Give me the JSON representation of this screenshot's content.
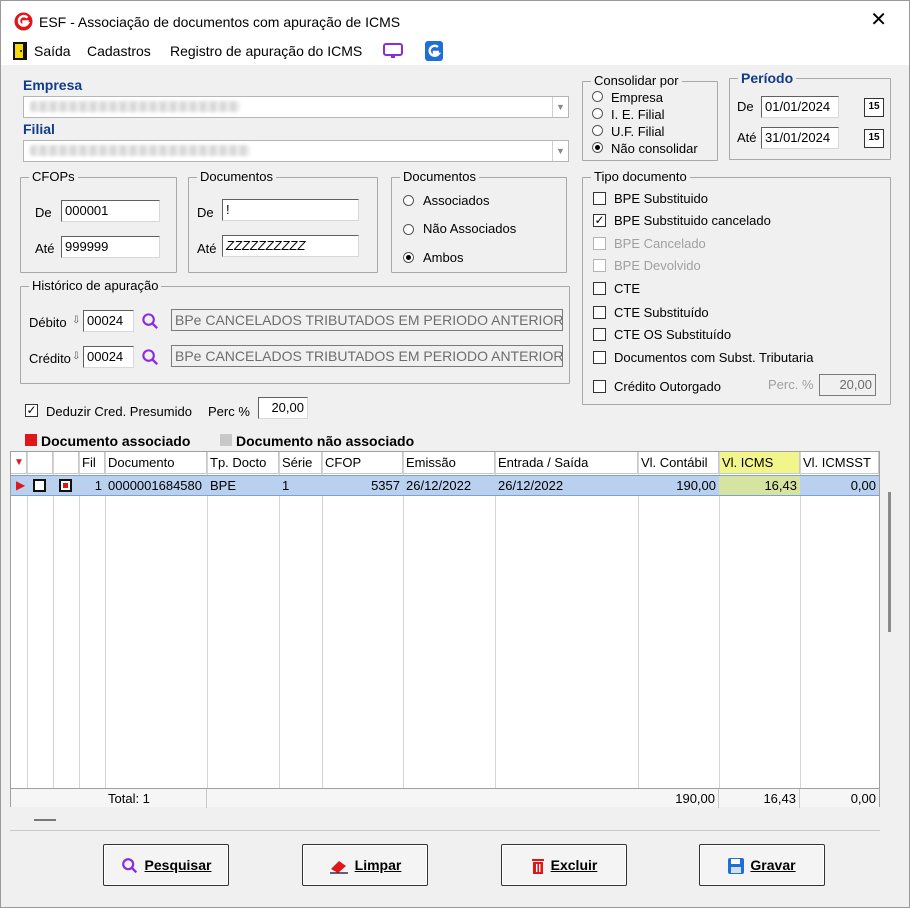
{
  "window": {
    "title": "ESF - Associação de documentos com apuração de ICMS"
  },
  "menu": {
    "items": [
      "Saída",
      "Cadastros",
      "Registro de apuração do ICMS"
    ]
  },
  "empresa": {
    "label": "Empresa"
  },
  "filial": {
    "label": "Filial"
  },
  "consolidar": {
    "title": "Consolidar por",
    "options": [
      "Empresa",
      "I. E. Filial",
      "U.F. Filial",
      "Não consolidar"
    ],
    "selected": "Não consolidar"
  },
  "periodo": {
    "title": "Período",
    "de_label": "De",
    "de_value": "01/01/2024",
    "ate_label": "Até",
    "ate_value": "31/01/2024",
    "cal_icon_text": "15"
  },
  "cfops": {
    "title": "CFOPs",
    "de_label": "De",
    "de_value": "000001",
    "ate_label": "Até",
    "ate_value": "999999"
  },
  "documentos_range": {
    "title": "Documentos",
    "de_label": "De",
    "de_value": "!",
    "ate_label": "Até",
    "ate_value": "ZZZZZZZZZZ"
  },
  "documentos_filter": {
    "title": "Documentos",
    "options": [
      "Associados",
      "Não Associados",
      "Ambos"
    ],
    "selected": "Ambos"
  },
  "tipo_documento": {
    "title": "Tipo documento",
    "items": [
      {
        "label": "BPE Substituido",
        "checked": false,
        "enabled": true
      },
      {
        "label": "BPE Substituido cancelado",
        "checked": true,
        "enabled": true
      },
      {
        "label": "BPE Cancelado",
        "checked": false,
        "enabled": false
      },
      {
        "label": "BPE Devolvido",
        "checked": false,
        "enabled": false
      },
      {
        "label": "CTE",
        "checked": false,
        "enabled": true
      },
      {
        "label": "CTE Substituído",
        "checked": false,
        "enabled": true
      },
      {
        "label": "CTE OS Substituído",
        "checked": false,
        "enabled": true
      },
      {
        "label": "Documentos com Subst. Tributaria",
        "checked": false,
        "enabled": true
      },
      {
        "label": "Crédito Outorgado",
        "checked": false,
        "enabled": true
      }
    ],
    "perc_label": "Perc. %",
    "perc_value": "20,00"
  },
  "historico": {
    "title": "Histórico de apuração",
    "debito_label": "Débito",
    "debito_code": "00024",
    "debito_desc": "BPe CANCELADOS TRIBUTADOS EM PERIODO ANTERIOR",
    "credito_label": "Crédito",
    "credito_code": "00024",
    "credito_desc": "BPe CANCELADOS TRIBUTADOS EM PERIODO ANTERIOR"
  },
  "deduzir": {
    "label": "Deduzir Cred. Presumido",
    "checked": true,
    "perc_label": "Perc %",
    "perc_value": "20,00"
  },
  "legend": {
    "associado": "Documento associado",
    "nao_associado": "Documento não associado"
  },
  "table": {
    "columns": [
      "Fil",
      "Documento",
      "Tp. Docto",
      "Série",
      "CFOP",
      "Emissão",
      "Entrada / Saída",
      "Vl. Contábil",
      "Vl. ICMS",
      "Vl. ICMSST"
    ],
    "rows": [
      {
        "fil": "1",
        "documento": "0000001684580",
        "tp_docto": "BPE",
        "serie": "1",
        "cfop": "5357",
        "emissao": "26/12/2022",
        "entrada_saida": "26/12/2022",
        "vl_contabil": "190,00",
        "vl_icms": "16,43",
        "vl_icmsst": "0,00"
      }
    ],
    "totals": {
      "label": "Total: 1",
      "vl_contabil": "190,00",
      "vl_icms": "16,43",
      "vl_icmsst": "0,00"
    },
    "highlight_color": "#f2f58a"
  },
  "buttons": {
    "pesquisar": "Pesquisar",
    "limpar": "Limpar",
    "excluir": "Excluir",
    "gravar": "Gravar"
  },
  "colors": {
    "accent_red": "#e0161b",
    "accent_blue": "#1e6fd6",
    "purple": "#8a2be2"
  }
}
